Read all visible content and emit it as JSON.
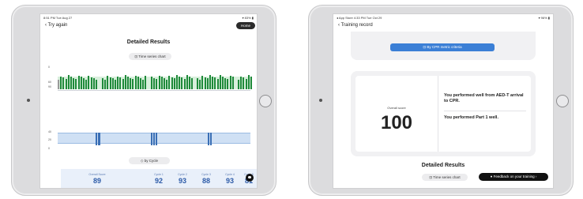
{
  "left_screen": {
    "status_time": "8:51 PM  Tue Aug 27",
    "status_right": "▾ 83% ▮",
    "back_label": "Try again",
    "home_label": "Home",
    "title": "Detailed Results",
    "time_series_label": "Time series chart",
    "by_cycle_label": "by Cycle",
    "y_top_ticks": [
      "0",
      "60",
      "90"
    ],
    "y_bottom_ticks": [
      "40",
      "20",
      "0"
    ],
    "overall_label": "Overall Score",
    "overall_value": "89",
    "cycles": [
      {
        "label": "Cycle 1",
        "value": "92"
      },
      {
        "label": "Cycle 2",
        "value": "93"
      },
      {
        "label": "Cycle 3",
        "value": "88"
      },
      {
        "label": "Cycle 4",
        "value": "93"
      },
      {
        "label": "Cycle 5",
        "value": "81"
      }
    ]
  },
  "right_screen": {
    "status_time": "◂ App Store  4:33 PM  Tue Oct 29",
    "status_right": "▾ 96% ▮",
    "back_label": "Training record",
    "cpr_metric_label": "By CPR metric criteria",
    "overall_label": "Overall score",
    "overall_value": "100",
    "msg1": "You performed well from AED-T arrival to CPR.",
    "msg2": "You performed Part 1 well.",
    "detailed_title": "Detailed Results",
    "time_series_label": "Time series chart",
    "feedback_label": "Feedback on your training"
  }
}
